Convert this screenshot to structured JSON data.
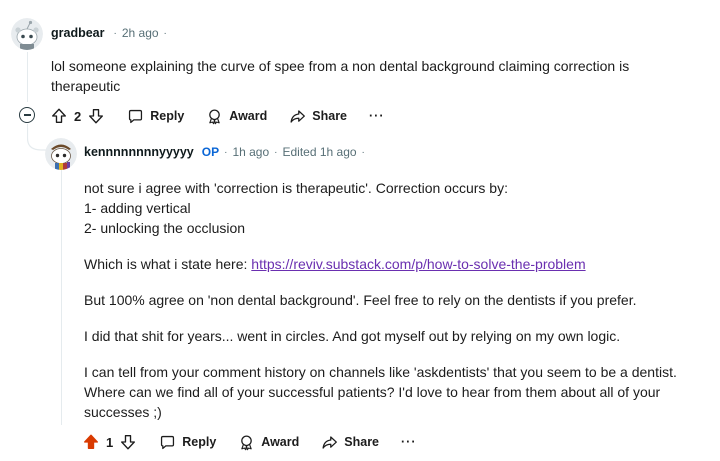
{
  "comments": [
    {
      "author": "gradbear",
      "time": "2h ago",
      "body": [
        "lol someone explaining the curve of spee from a non dental background claiming correction is therapeutic"
      ],
      "votes": "2",
      "actions": {
        "reply": "Reply",
        "award": "Award",
        "share": "Share",
        "more": "···"
      }
    },
    {
      "author": "kennnnnnnnyyyyy",
      "badge": "OP",
      "time": "1h ago",
      "edited": "Edited 1h ago",
      "body": {
        "p1_lines": [
          "not sure i agree with 'correction is therapeutic'. Correction occurs by:",
          "1- adding vertical",
          "2- unlocking the occlusion"
        ],
        "p2_prefix": "Which is what i state here: ",
        "p2_link": "https://reviv.substack.com/p/how-to-solve-the-problem",
        "p3": "But 100% agree on 'non dental background'. Feel free to rely on the dentists if you prefer.",
        "p4": "I did that shit for years... went in circles. And got myself out by relying on my own logic.",
        "p5": "I can tell from your comment history on channels like 'askdentists' that you seem to be a dentist. Where can we find all of your successful patients? I'd love to hear from them about all of your successes ;)"
      },
      "votes": "1",
      "upvoted": true,
      "actions": {
        "reply": "Reply",
        "award": "Award",
        "share": "Share",
        "more": "···"
      }
    }
  ],
  "colors": {
    "upvote_active": "#d93a00",
    "link": "#6a2fb0",
    "op_badge": "#0a66d6",
    "meta": "#576f76"
  },
  "icons": [
    "reddit-avatar-icon",
    "collapse-icon",
    "upvote-icon",
    "downvote-icon",
    "reply-icon",
    "award-icon",
    "share-icon",
    "more-icon"
  ]
}
